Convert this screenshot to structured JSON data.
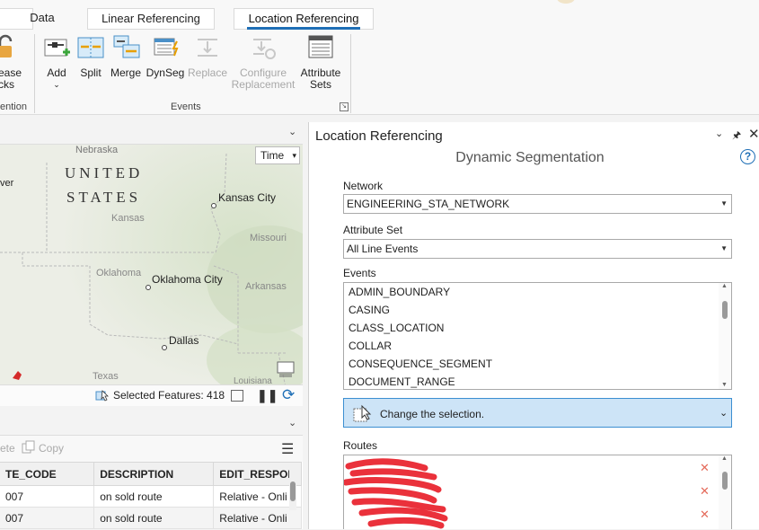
{
  "ribbon": {
    "tabs": [
      {
        "label": "Data",
        "active": false
      },
      {
        "label": "Linear Referencing",
        "active": false
      },
      {
        "label": "Location Referencing",
        "active": true
      }
    ],
    "partial_button": {
      "line1": "ease",
      "line2": "cks"
    },
    "partial_group_label": "ention",
    "buttons": [
      {
        "label": "Add",
        "icon": "add-event-icon",
        "disabled": false
      },
      {
        "label": "Split",
        "icon": "split-event-icon",
        "disabled": false
      },
      {
        "label": "Merge",
        "icon": "merge-event-icon",
        "disabled": false
      },
      {
        "label": "DynSeg",
        "icon": "dynseg-icon",
        "disabled": false
      },
      {
        "label": "Replace",
        "icon": "replace-icon",
        "disabled": true
      },
      {
        "label": "Configure Replacement",
        "label_line1": "Configure",
        "label_line2": "Replacement",
        "icon": "configure-replacement-icon",
        "disabled": true
      },
      {
        "label": "Attribute Sets",
        "label_line1": "Attribute",
        "label_line2": "Sets",
        "icon": "attribute-sets-icon",
        "disabled": false
      }
    ],
    "events_group_label": "Events"
  },
  "map": {
    "time_label": "Time",
    "labels": {
      "nebraska": "Nebraska",
      "united": "UNITED",
      "states": "STATES",
      "kansas": "Kansas",
      "kansas_city": "Kansas City",
      "missouri": "Missouri",
      "oklahoma": "Oklahoma",
      "oklahoma_city": "Oklahoma City",
      "arkansas": "Arkansas",
      "dallas": "Dallas",
      "texas": "Texas",
      "louisiana": "Louisiana",
      "denver_partial": "ver"
    },
    "status": {
      "selected_label": "Selected Features: 418"
    }
  },
  "table": {
    "toolbar": {
      "delete_partial": "ete",
      "copy_label": "Copy"
    },
    "columns": [
      "TE_CODE",
      "DESCRIPTION",
      "EDIT_RESPON"
    ],
    "rows": [
      [
        "007",
        "on sold route",
        "Relative - Onli"
      ],
      [
        "007",
        "on sold route",
        "Relative - Onli"
      ]
    ]
  },
  "pane": {
    "title": "Location Referencing",
    "subtitle": "Dynamic Segmentation",
    "network_label": "Network",
    "network_value": "ENGINEERING_STA_NETWORK",
    "attribute_set_label": "Attribute Set",
    "attribute_set_value": "All Line Events",
    "events_label": "Events",
    "events": [
      "ADMIN_BOUNDARY",
      "CASING",
      "CLASS_LOCATION",
      "COLLAR",
      "CONSEQUENCE_SEGMENT",
      "DOCUMENT_RANGE"
    ],
    "change_selection_label": "Change the selection.",
    "routes_label": "Routes"
  },
  "colors": {
    "accent": "#1f6fb6",
    "selection_bg": "#cde4f7",
    "selection_border": "#3c8fd1",
    "redaction": "#e8202a",
    "remove_x": "#e46a5a"
  }
}
